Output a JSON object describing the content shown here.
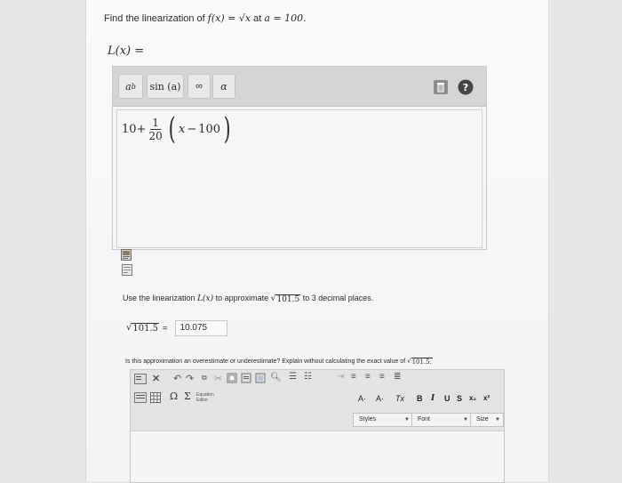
{
  "question": {
    "prefix": "Find the linearization of",
    "fx": "f(x) = √x",
    "mid": "at",
    "avalue": "a = 100."
  },
  "lhs": "L(x) =",
  "math_toolbar": {
    "power": "a",
    "power_sup": "b",
    "sin": "sin (a)",
    "infinity": "∞",
    "alpha": "α"
  },
  "answer_expr": {
    "constant": "10+",
    "num": "1",
    "den": "20",
    "x": "x",
    "minus": "−",
    "c": "100"
  },
  "q2": {
    "pre": "Use the linearization",
    "lx": "L(x)",
    "mid": "to approximate",
    "sqrt_val": "101.5",
    "post": "to 3 decimal places."
  },
  "approx": {
    "sqrt_val": "101.5",
    "approx_sign": "≈",
    "value": "10.075"
  },
  "q3": {
    "text": "Is this approximation an overestimate or underestimate? Explain without calculating the exact value of",
    "sqrt_val": "101.5."
  },
  "rte": {
    "omega": "Ω",
    "sigma": "Σ",
    "eq_editor": "Equation Editor",
    "font_color": "A·",
    "bg_color": "A·",
    "clear": "Tx",
    "bold": "B",
    "italic": "I",
    "underline": "U",
    "strike": "S",
    "sub": "x₂",
    "sup": "x²",
    "styles": "Styles",
    "font": "Font",
    "size": "Size"
  }
}
